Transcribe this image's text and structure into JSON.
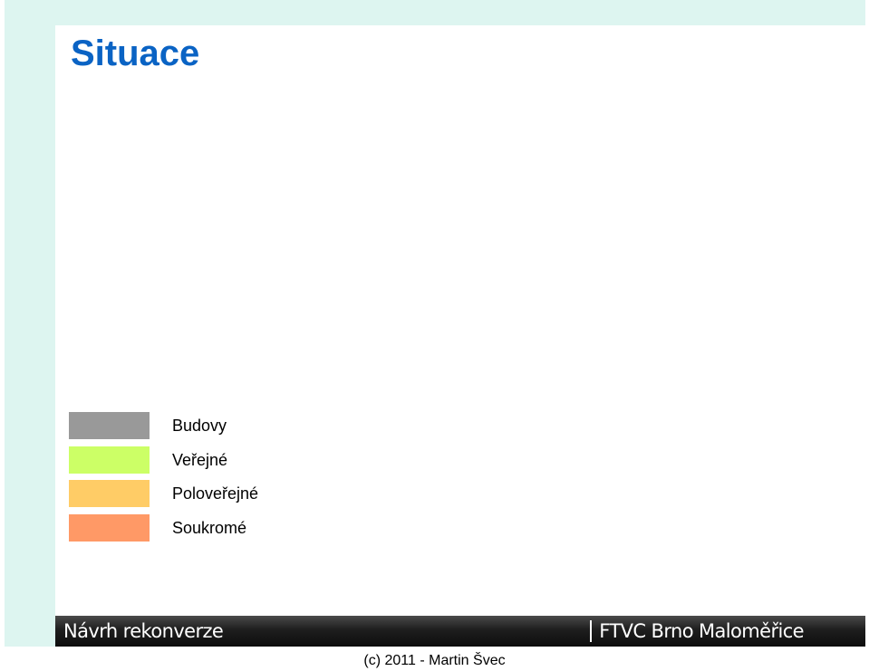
{
  "slide": {
    "title": "Situace"
  },
  "legend": {
    "items": [
      {
        "label": "Budovy",
        "color": "#999999"
      },
      {
        "label": "Veřejné",
        "color": "#ccff66"
      },
      {
        "label": "Poloveřejné",
        "color": "#ffcc66"
      },
      {
        "label": "Soukromé",
        "color": "#ff9966"
      }
    ]
  },
  "footer": {
    "left_text": "Návrh rekonverze",
    "right_text": "FTVC Brno Maloměřice"
  },
  "copyright": "(c) 2011 - Martin Švec",
  "colors": {
    "title": "#0a63c4",
    "band": "#ddf5f0"
  }
}
